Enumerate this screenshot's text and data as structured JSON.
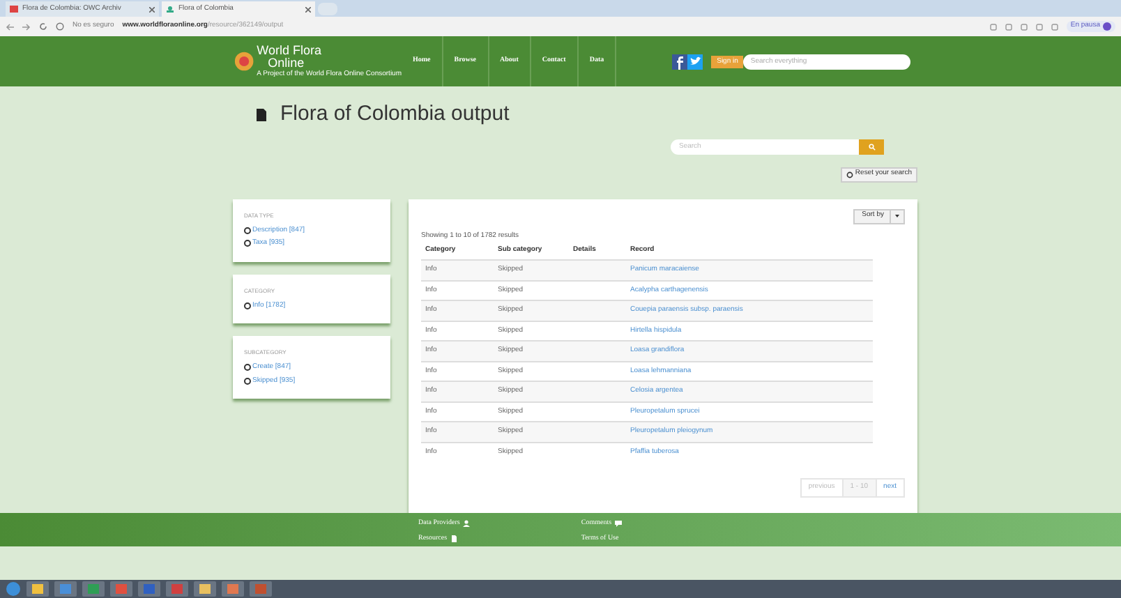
{
  "browser": {
    "tabs": [
      {
        "label": "Flora de Colombia: OWC Archiv",
        "selected": false
      },
      {
        "label": "Flora of Colombia",
        "selected": true
      }
    ],
    "security": "No es seguro",
    "url_host": "www.worldfloraonline.org",
    "url_path": "/resource/362149/output",
    "profile": "En pausa"
  },
  "header": {
    "logo_line1": "World Flora",
    "logo_line2": "Online",
    "tagline": "A Project of the World Flora Online Consortium",
    "nav": [
      "Home",
      "Browse",
      "About",
      "Contact",
      "Data"
    ],
    "sign_in": "Sign in",
    "search_placeholder": "Search everything"
  },
  "page_title": "Flora of Colombia output",
  "search": {
    "placeholder": "Search"
  },
  "reset": "Reset your search",
  "facets": [
    {
      "title": "DATA TYPE",
      "options": [
        "Description [847]",
        "Taxa [935]"
      ]
    },
    {
      "title": "CATEGORY",
      "options": [
        "Info [1782]"
      ]
    },
    {
      "title": "SUBCATEGORY",
      "options": [
        "Create [847]",
        "Skipped [935]"
      ]
    }
  ],
  "sort": "Sort by",
  "summary": "Showing 1 to 10 of 1782 results",
  "table": {
    "columns": [
      "Category",
      "Sub category",
      "Details",
      "Record"
    ],
    "rows": [
      [
        "Info",
        "Skipped",
        "",
        "Panicum maracaiense"
      ],
      [
        "Info",
        "Skipped",
        "",
        "Acalypha carthagenensis"
      ],
      [
        "Info",
        "Skipped",
        "",
        "Couepia paraensis subsp. paraensis"
      ],
      [
        "Info",
        "Skipped",
        "",
        "Hirtella hispidula"
      ],
      [
        "Info",
        "Skipped",
        "",
        "Loasa grandiflora"
      ],
      [
        "Info",
        "Skipped",
        "",
        "Loasa lehmanniana"
      ],
      [
        "Info",
        "Skipped",
        "",
        "Celosia argentea"
      ],
      [
        "Info",
        "Skipped",
        "",
        "Pleuropetalum sprucei"
      ],
      [
        "Info",
        "Skipped",
        "",
        "Pleuropetalum pleiogynum"
      ],
      [
        "Info",
        "Skipped",
        "",
        "Pfaffia tuberosa"
      ]
    ]
  },
  "pagination": {
    "previous": "previous",
    "range": "1 - 10",
    "next": "next"
  },
  "footer": [
    {
      "label": "Data Providers",
      "kind": "person"
    },
    {
      "label": "Resources",
      "kind": "file"
    },
    {
      "label": "Comments",
      "kind": "comment"
    },
    {
      "label": "Terms of Use",
      "kind": "none"
    }
  ]
}
